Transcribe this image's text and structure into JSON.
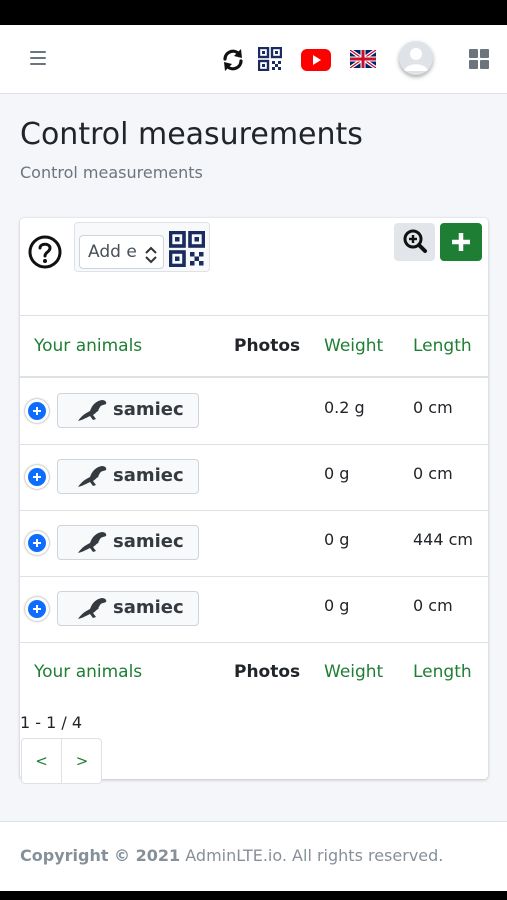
{
  "navbar": {
    "menu_icon": "hamburger-menu-icon",
    "sync_icon": "sync-icon",
    "qr_icon": "qr-code-icon",
    "youtube_icon": "youtube-icon",
    "flag_icon": "uk-flag-icon",
    "avatar_icon": "user-avatar-icon",
    "apps_icon": "grid-apps-icon"
  },
  "page": {
    "title": "Control measurements",
    "subtitle": "Control measurements"
  },
  "toolbar": {
    "help_icon": "question-circle-icon",
    "select_value": "Add e",
    "qr_icon": "qr-code-icon",
    "zoom_icon": "search-plus-icon",
    "add_icon": "plus-icon"
  },
  "table": {
    "headers": [
      "Your animals",
      "Photos",
      "Weight",
      "Length"
    ],
    "rows": [
      {
        "animal": "samiec",
        "photos": "",
        "weight": "0.2 g",
        "length": "0 cm"
      },
      {
        "animal": "samiec",
        "photos": "",
        "weight": "0 g",
        "length": "0 cm"
      },
      {
        "animal": "samiec",
        "photos": "",
        "weight": "0 g",
        "length": "444 cm"
      },
      {
        "animal": "samiec",
        "photos": "",
        "weight": "0 g",
        "length": "0 cm"
      }
    ],
    "footers": [
      "Your animals",
      "Photos",
      "Weight",
      "Length"
    ]
  },
  "pagination": {
    "info": "1 - 1 / 4",
    "prev": "<",
    "next": ">"
  },
  "footer": {
    "copyright": "Copyright © 2021",
    "brand": "AdminLTE.io",
    "rights": ". All rights reserved."
  },
  "colors": {
    "accent_green": "#1e7e34",
    "expand_blue": "#0d6efd",
    "youtube_red": "#ff0000",
    "qr_navy": "#1a2b5f"
  }
}
